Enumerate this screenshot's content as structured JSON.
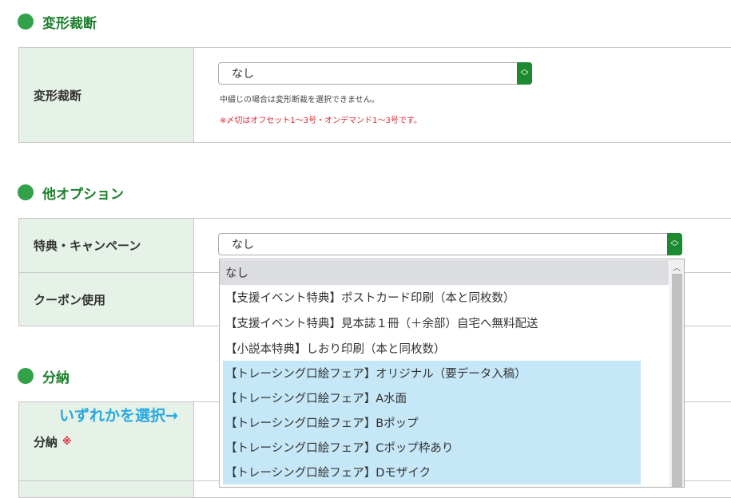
{
  "sections": {
    "deform": {
      "title": "変形裁断",
      "row_label": "変形裁断",
      "select_value": "なし",
      "note1": "中綴じの場合は変形断裁を選択できません。",
      "note2": "※〆切はオフセット1～3号・オンデマンド1～3号です。"
    },
    "other_options": {
      "title": "他オプション",
      "row1_label": "特典・キャンペーン",
      "row1_select_value": "なし",
      "row2_label": "クーポン使用"
    },
    "delivery": {
      "title": "分納",
      "row_label": "分納",
      "required_mark": "※"
    }
  },
  "dropdown": {
    "options": [
      "なし",
      "【支援イベント特典】ポストカード印刷（本と同枚数）",
      "【支援イベント特典】見本誌１冊（＋余部）自宅へ無料配送",
      "【小説本特典】しおり印刷（本と同枚数）",
      "【トレーシング口絵フェア】オリジナル（要データ入稿）",
      "【トレーシング口絵フェア】A水面",
      "【トレーシング口絵フェア】Bポップ",
      "【トレーシング口絵フェア】Cポップ枠あり",
      "【トレーシング口絵フェア】Dモザイク"
    ],
    "selected_index": 0,
    "highlighted_indices": [
      4,
      5,
      6,
      7,
      8
    ]
  },
  "annotation": "いずれかを選択→",
  "icons": {
    "select_arrow": "up-down-chevron-icon",
    "section_marker": "green-dot-icon",
    "scroll_up": "scroll-up-arrow-icon"
  },
  "colors": {
    "accent_green": "#1e8a2f",
    "header_bg": "#e6f1e8",
    "highlight": "#c5e7f7",
    "annotation": "#29a8e0",
    "required": "#e0262e"
  }
}
